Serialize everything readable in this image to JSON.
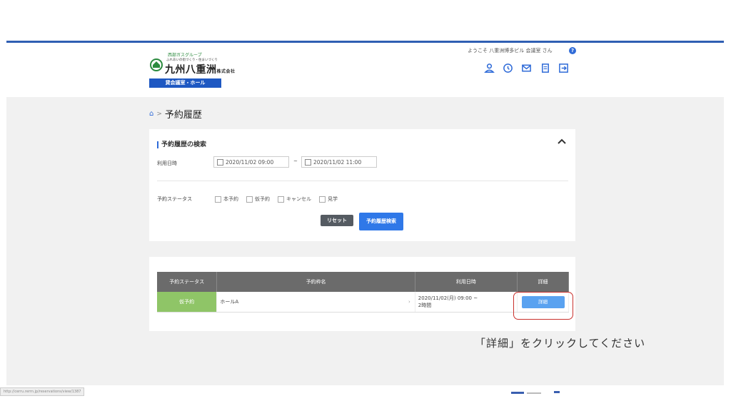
{
  "header": {
    "logo": {
      "group": "西部ガスグループ",
      "tagline": "ふれあいの街づくり・住まいづくり",
      "company": "九州八重洲",
      "suffix": "株式会社",
      "service": "貸会議室・ホール"
    },
    "welcome": "ようこそ 八重洲博多ビル 会議室 さん",
    "help_icon": "?",
    "icons": [
      "user-icon",
      "history-icon",
      "mail-icon",
      "document-icon",
      "logout-icon"
    ],
    "accent_color": "#2f5fb3"
  },
  "breadcrumb": {
    "home_icon": "⌂",
    "separator": ">",
    "current": "予約履歴"
  },
  "search": {
    "title": "予約履歴の検索",
    "date_label": "利用日時",
    "date_from": "2020/11/02 09:00",
    "date_separator": "~",
    "date_to": "2020/11/02 11:00",
    "status_label": "予約ステータス",
    "status_options": [
      "本予約",
      "仮予約",
      "キャンセル",
      "見学"
    ],
    "reset_label": "リセット",
    "search_label": "予約履歴検索"
  },
  "results": {
    "columns": [
      "予約ステータス",
      "予約枠名",
      "利用日時",
      "詳細"
    ],
    "rows": [
      {
        "status": "仮予約",
        "name": "ホールA",
        "datetime_line1": "2020/11/02(月) 09:00 ~",
        "datetime_line2": "2時間",
        "detail_label": "詳細"
      }
    ],
    "status_color": "#8fc567"
  },
  "annotation": "「詳細」をクリックしてください",
  "statusbar_url": "http://cerru.rerrn.jp/reservations/view/1387"
}
